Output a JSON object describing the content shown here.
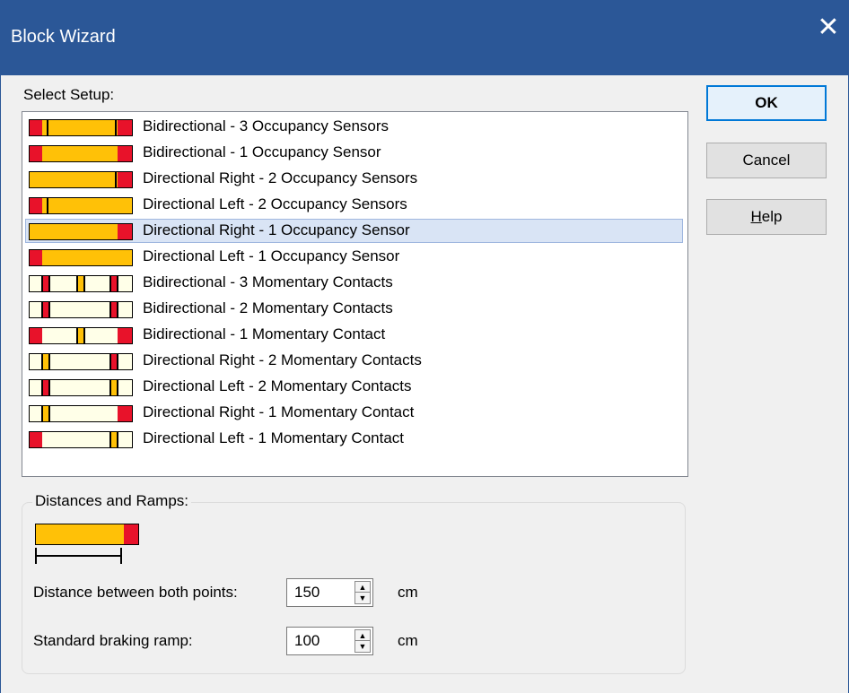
{
  "window": {
    "title": "Block Wizard",
    "close_glyph": "✕"
  },
  "setup": {
    "label": "Select Setup:",
    "selected_index": 4,
    "items": [
      {
        "label": "Bidirectional - 3 Occupancy Sensors",
        "style": "bi3occ"
      },
      {
        "label": "Bidirectional - 1 Occupancy Sensor",
        "style": "bi1occ"
      },
      {
        "label": "Directional Right - 2 Occupancy Sensors",
        "style": "dr2occ"
      },
      {
        "label": "Directional Left - 2 Occupancy Sensors",
        "style": "dl2occ"
      },
      {
        "label": "Directional Right - 1 Occupancy Sensor",
        "style": "dr1occ"
      },
      {
        "label": "Directional Left - 1 Occupancy Sensor",
        "style": "dl1occ"
      },
      {
        "label": "Bidirectional - 3 Momentary Contacts",
        "style": "bi3mom"
      },
      {
        "label": "Bidirectional - 2 Momentary Contacts",
        "style": "bi2mom"
      },
      {
        "label": "Bidirectional - 1 Momentary Contact",
        "style": "bi1mom"
      },
      {
        "label": "Directional Right - 2 Momentary Contacts",
        "style": "dr2mom"
      },
      {
        "label": "Directional Left - 2 Momentary Contacts",
        "style": "dl2mom"
      },
      {
        "label": "Directional Right - 1 Momentary Contact",
        "style": "dr1mom"
      },
      {
        "label": "Directional Left - 1 Momentary Contact",
        "style": "dl1mom"
      }
    ]
  },
  "buttons": {
    "ok": "OK",
    "cancel": "Cancel",
    "help": "Help"
  },
  "distances": {
    "group_label": "Distances and Ramps:",
    "preview_style": "dr1occ",
    "fields": [
      {
        "label": "Distance between both points:",
        "value": "150",
        "unit": "cm"
      },
      {
        "label": "Standard braking ramp:",
        "value": "100",
        "unit": "cm"
      }
    ]
  },
  "colors": {
    "titlebar": "#2b5797",
    "stop_section": "#e8122a",
    "track_section": "#ffc107",
    "contact_background": "#ffffe8",
    "selection": "#d9e4f5"
  },
  "icons": {
    "close": "close-icon",
    "spin_up": "spin-up-icon",
    "spin_down": "spin-down-icon"
  }
}
